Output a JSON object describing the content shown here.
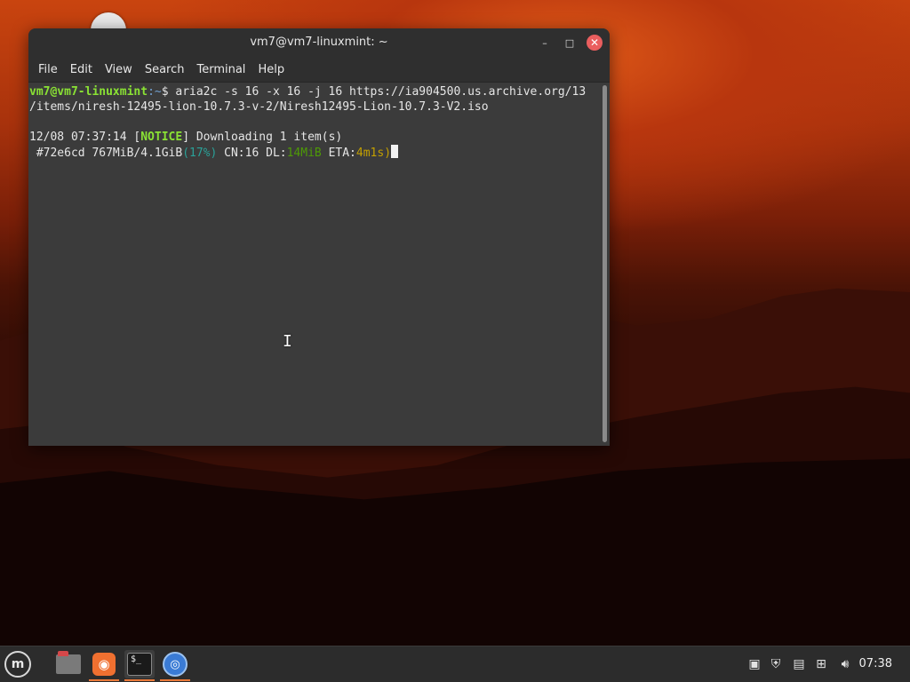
{
  "window": {
    "title": "vm7@vm7-linuxmint: ~",
    "controls": {
      "minimize": "–",
      "maximize": "□",
      "close": "✕"
    }
  },
  "menubar": [
    "File",
    "Edit",
    "View",
    "Search",
    "Terminal",
    "Help"
  ],
  "terminal": {
    "prompt_user": "vm7@vm7-linuxmint",
    "prompt_path": ":~",
    "prompt_symbol": "$ ",
    "command_line1": "aria2c -s 16 -x 16 -j 16 https://ia904500.us.archive.org/13",
    "command_line2": "/items/niresh-12495-lion-10.7.3-v-2/Niresh12495-Lion-10.7.3-V2.iso",
    "notice_time": "12/08 07:37:14 [",
    "notice_tag": "NOTICE",
    "notice_msg": "] Downloading 1 item(s)",
    "progress_prefix": " #72e6cd 767MiB/4.1GiB",
    "progress_pct": "(17%)",
    "progress_cn": " CN:16 DL:",
    "progress_dl": "14MiB",
    "progress_eta_label": " ETA:",
    "progress_eta": "4m1s",
    "progress_end": ")",
    "progress_bracket": "["
  },
  "taskbar": {
    "menu_icon": "linux-mint-menu-icon",
    "apps": [
      "files-icon",
      "firefox-icon",
      "terminal-icon",
      "web-browser-icon"
    ],
    "tray": [
      "clipboard-icon",
      "shield-icon",
      "update-icon",
      "network-icon",
      "volume-icon"
    ],
    "clock": "07:38"
  },
  "colors": {
    "accent": "#ea7a3a",
    "prompt": "#8ae234",
    "close": "#ea5e5e"
  }
}
